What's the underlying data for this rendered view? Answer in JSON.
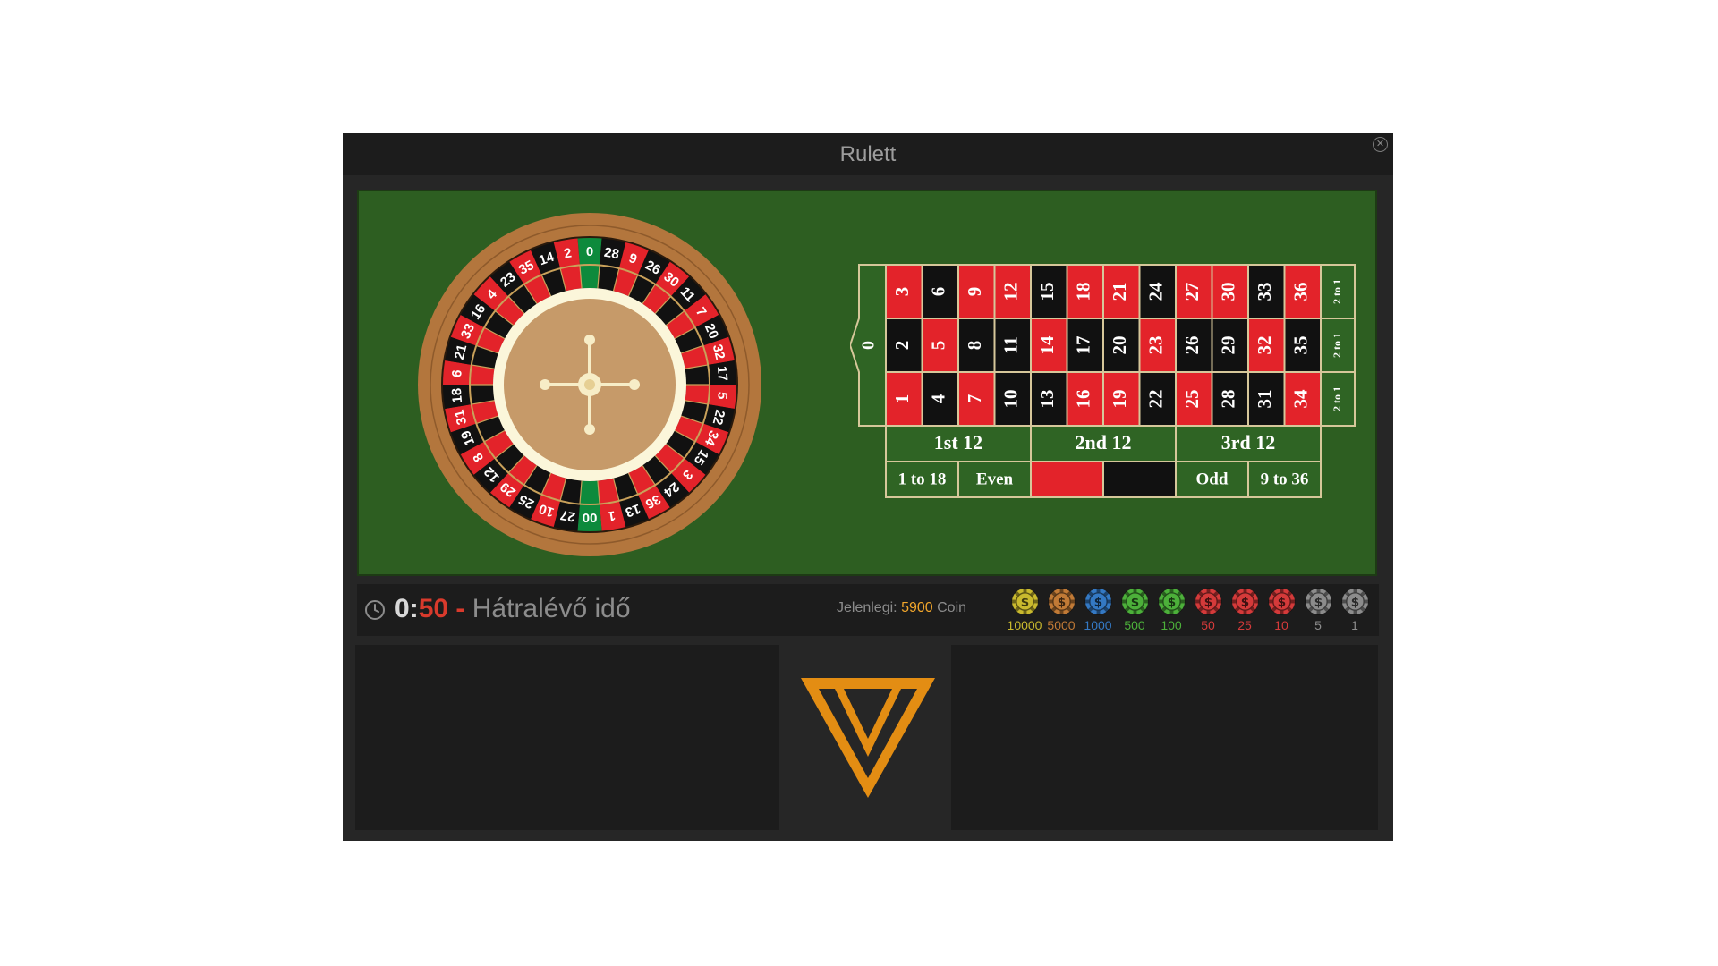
{
  "window": {
    "title": "Rulett",
    "close_icon": "close-circle-icon"
  },
  "wheel": {
    "pockets": [
      "0",
      "28",
      "9",
      "26",
      "30",
      "11",
      "7",
      "20",
      "32",
      "17",
      "5",
      "22",
      "34",
      "15",
      "3",
      "24",
      "36",
      "13",
      "1",
      "00",
      "27",
      "10",
      "25",
      "29",
      "12",
      "8",
      "19",
      "31",
      "18",
      "6",
      "21",
      "33",
      "16",
      "4",
      "23",
      "35",
      "14",
      "2"
    ],
    "colors": {
      "red": "#e3232a",
      "black": "#111111",
      "green": "#0d8a3c",
      "rim": "#b3763d",
      "hub": "#c69a69",
      "hub_ring": "#fbf6da",
      "spokes": "#f7edc7"
    }
  },
  "board": {
    "zero_label": "0",
    "numbers": [
      {
        "n": "3",
        "c": "red"
      },
      {
        "n": "6",
        "c": "black"
      },
      {
        "n": "9",
        "c": "red"
      },
      {
        "n": "12",
        "c": "red"
      },
      {
        "n": "15",
        "c": "black"
      },
      {
        "n": "18",
        "c": "red"
      },
      {
        "n": "21",
        "c": "red"
      },
      {
        "n": "24",
        "c": "black"
      },
      {
        "n": "27",
        "c": "red"
      },
      {
        "n": "30",
        "c": "red"
      },
      {
        "n": "33",
        "c": "black"
      },
      {
        "n": "36",
        "c": "red"
      },
      {
        "n": "2",
        "c": "black"
      },
      {
        "n": "5",
        "c": "red"
      },
      {
        "n": "8",
        "c": "black"
      },
      {
        "n": "11",
        "c": "black"
      },
      {
        "n": "14",
        "c": "red"
      },
      {
        "n": "17",
        "c": "black"
      },
      {
        "n": "20",
        "c": "black"
      },
      {
        "n": "23",
        "c": "red"
      },
      {
        "n": "26",
        "c": "black"
      },
      {
        "n": "29",
        "c": "black"
      },
      {
        "n": "32",
        "c": "red"
      },
      {
        "n": "35",
        "c": "black"
      },
      {
        "n": "1",
        "c": "red"
      },
      {
        "n": "4",
        "c": "black"
      },
      {
        "n": "7",
        "c": "red"
      },
      {
        "n": "10",
        "c": "black"
      },
      {
        "n": "13",
        "c": "black"
      },
      {
        "n": "16",
        "c": "red"
      },
      {
        "n": "19",
        "c": "red"
      },
      {
        "n": "22",
        "c": "black"
      },
      {
        "n": "25",
        "c": "red"
      },
      {
        "n": "28",
        "c": "black"
      },
      {
        "n": "31",
        "c": "black"
      },
      {
        "n": "34",
        "c": "red"
      }
    ],
    "column_bets": [
      "2 to 1",
      "2 to 1",
      "2 to 1"
    ],
    "dozens": [
      "1st 12",
      "2nd 12",
      "3rd 12"
    ],
    "outside": [
      "1 to 18",
      "Even",
      "",
      "",
      "Odd",
      "9 to 36"
    ],
    "felt_color": "#2d5e21",
    "border_color": "#d6c79a"
  },
  "status": {
    "clock_icon": "clock-icon",
    "timer_minutes": "0",
    "timer_sep": ":",
    "timer_seconds": "50",
    "timer_dash": "-",
    "timer_label": "Hátralévő idő",
    "balance_label": "Jelenlegi:",
    "balance_amount": "5900",
    "balance_unit": "Coin"
  },
  "chips": [
    {
      "value": "10000",
      "color": "#c9b92e"
    },
    {
      "value": "5000",
      "color": "#c17a36"
    },
    {
      "value": "1000",
      "color": "#3479c4"
    },
    {
      "value": "500",
      "color": "#4cb03a"
    },
    {
      "value": "100",
      "color": "#4cb03a"
    },
    {
      "value": "50",
      "color": "#d43a3a"
    },
    {
      "value": "25",
      "color": "#d43a3a"
    },
    {
      "value": "10",
      "color": "#d43a3a"
    },
    {
      "value": "5",
      "color": "#8c8c8c"
    },
    {
      "value": "1",
      "color": "#8c8c8c"
    }
  ],
  "logo": {
    "icon": "triangle-logo-icon",
    "color": "#e38d13"
  }
}
